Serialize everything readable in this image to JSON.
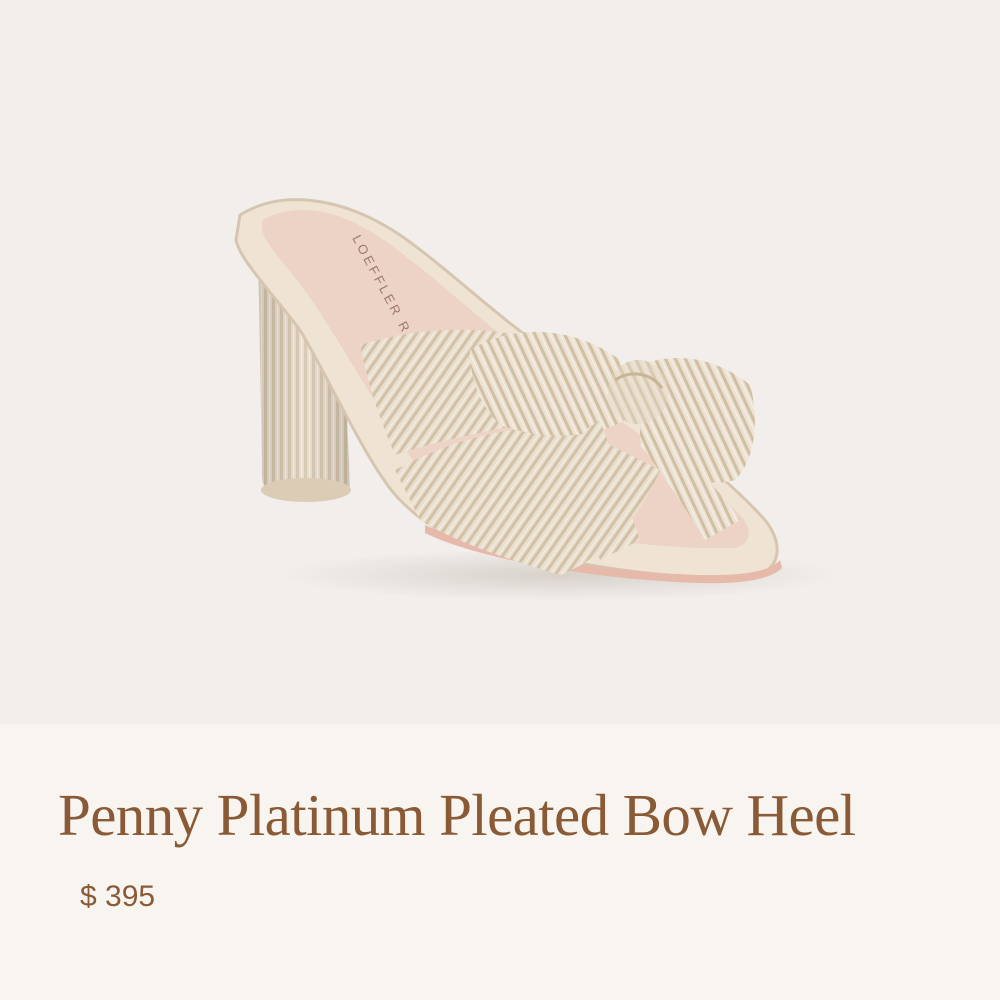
{
  "product": {
    "image_alt": "Penny Platinum Pleated Bow Heel",
    "insole_brand_text": "LOEFFLER RANDALL",
    "title": "Penny Platinum Pleated Bow Heel",
    "price": "$ 395"
  },
  "colors": {
    "photo_background": "#f1eeeb",
    "card_background": "#f8f5f0",
    "text": "#8a5a36"
  }
}
